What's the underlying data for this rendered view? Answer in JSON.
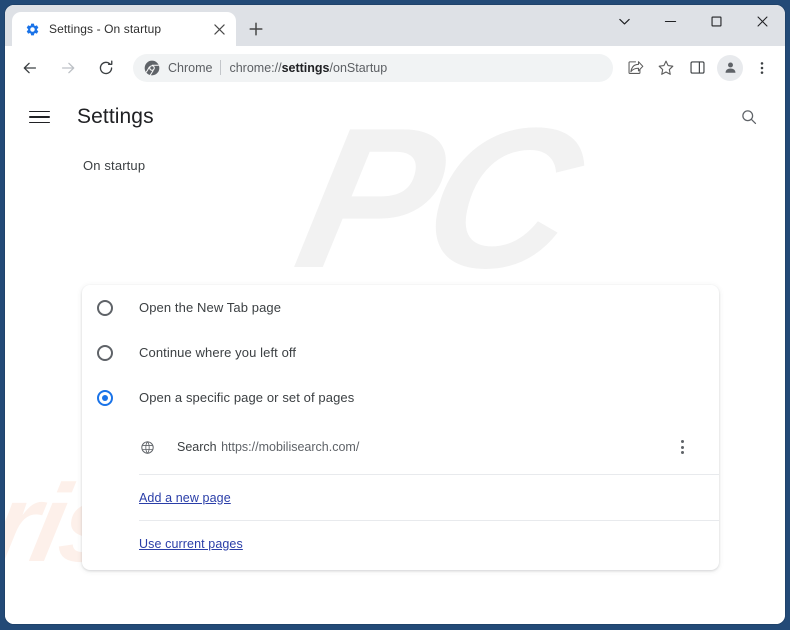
{
  "window": {
    "controls": {
      "tab_search_label": "Search tabs",
      "minimize_label": "Minimize",
      "maximize_label": "Maximize",
      "close_label": "Close"
    }
  },
  "tabstrip": {
    "tabs": [
      {
        "title": "Settings - On startup",
        "favicon": "gear-icon",
        "close_label": "Close tab",
        "active": true
      }
    ],
    "new_tab_label": "New Tab"
  },
  "toolbar": {
    "back_label": "Back",
    "forward_label": "Forward",
    "reload_label": "Reload",
    "omnibox": {
      "chip_text": "Chrome",
      "icon": "chrome-icon",
      "url_prefix": "chrome://",
      "url_bold": "settings",
      "url_suffix": "/onStartup",
      "full_url": "chrome://settings/onStartup"
    },
    "actions": [
      {
        "name": "share-icon",
        "label": "Share this page"
      },
      {
        "name": "star-icon",
        "label": "Bookmark this tab"
      },
      {
        "name": "side-panel-icon",
        "label": "Side panel"
      }
    ],
    "profile_label": "Profile",
    "menu_label": "Customize and control Google Chrome"
  },
  "settings": {
    "menu_label": "Main menu",
    "title": "Settings",
    "search_label": "Search settings",
    "section_heading": "On startup",
    "options": [
      {
        "label": "Open the New Tab page",
        "checked": false
      },
      {
        "label": "Continue where you left off",
        "checked": false
      },
      {
        "label": "Open a specific page or set of pages",
        "checked": true
      }
    ],
    "startup_pages": [
      {
        "title": "Search",
        "url": "https://mobilisearch.com/",
        "favicon": "globe-icon",
        "menu_label": "More actions"
      }
    ],
    "links": [
      {
        "label": "Add a new page",
        "name": "add-a-new-page-link"
      },
      {
        "label": "Use current pages",
        "name": "use-current-pages-link"
      }
    ]
  },
  "watermarks": {
    "primary": "PC",
    "secondary": "risk.com"
  },
  "colors": {
    "accent": "#1a73e8",
    "link": "#2a3ea8",
    "frame": "#234a77",
    "tabstrip": "#dee1e6",
    "omnibox_bg": "#f1f3f4"
  }
}
